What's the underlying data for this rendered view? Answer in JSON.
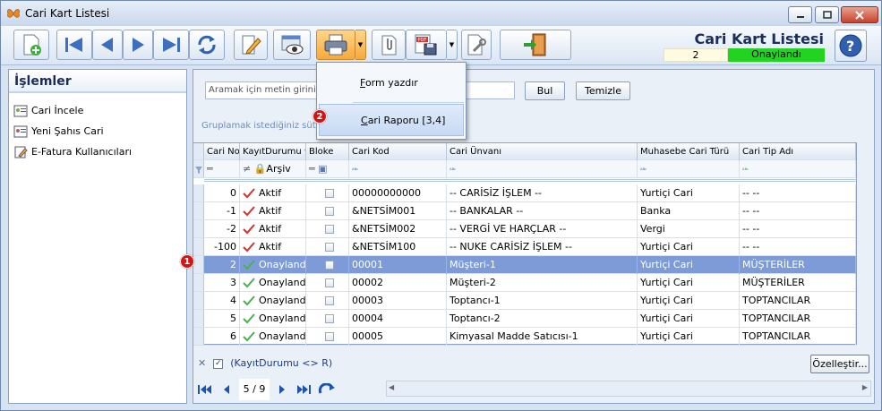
{
  "window": {
    "title": "Cari Kart Listesi"
  },
  "header": {
    "title": "Cari Kart Listesi",
    "record_no": "2",
    "status": "Onaylandı",
    "status_color": "#22d322"
  },
  "sidebar": {
    "title": "İşlemler",
    "items": [
      {
        "label": "Cari İncele",
        "icon": "person-card-icon"
      },
      {
        "label": "Yeni Şahıs Cari",
        "icon": "id-card-icon"
      },
      {
        "label": "E-Fatura Kullanıcıları",
        "icon": "document-edit-icon"
      }
    ]
  },
  "search": {
    "placeholder": "Aramak için metin giriniz...",
    "find_label": "Bul",
    "clear_label": "Temizle"
  },
  "group_hint": "Gruplamak istediğiniz sütun",
  "print_menu": {
    "items": [
      "Form yazdır",
      "Cari Raporu [3,4]"
    ],
    "underline": [
      "F",
      "C"
    ]
  },
  "grid": {
    "columns": [
      "Cari No",
      "KayıtDurumu",
      "Bloke",
      "Cari Kod",
      "Cari Ünvanı",
      "Muhasebe Cari Türü",
      "Cari Tip Adı"
    ],
    "filter_row": {
      "kayit": "Arşiv"
    },
    "rows": [
      {
        "no": "0",
        "status": "Aktif",
        "kod": "00000000000",
        "unvan": "-- CARİSİZ İŞLEM --",
        "tur": "Yurtiçi Cari",
        "tip": "-- --"
      },
      {
        "no": "-1",
        "status": "Aktif",
        "kod": "&NETSİM001",
        "unvan": "-- BANKALAR --",
        "tur": "Banka",
        "tip": "-- --"
      },
      {
        "no": "-2",
        "status": "Aktif",
        "kod": "&NETSİM002",
        "unvan": "-- VERGİ VE HARÇLAR --",
        "tur": "Vergi",
        "tip": "-- --"
      },
      {
        "no": "-100",
        "status": "Aktif",
        "kod": "&NETSİM100",
        "unvan": "-- NUKE CARİSİZ İŞLEM --",
        "tur": "Yurtiçi Cari",
        "tip": "-- --"
      },
      {
        "no": "2",
        "status": "Onaylandı",
        "kod": "00001",
        "unvan": "Müşteri-1",
        "tur": "Yurtiçi Cari",
        "tip": "MÜŞTERİLER"
      },
      {
        "no": "3",
        "status": "Onaylandı",
        "kod": "00002",
        "unvan": "Müşteri-2",
        "tur": "Yurtiçi Cari",
        "tip": "MÜŞTERİLER"
      },
      {
        "no": "4",
        "status": "Onaylandı",
        "kod": "00003",
        "unvan": "Toptancı-1",
        "tur": "Yurtiçi Cari",
        "tip": "TOPTANCILAR"
      },
      {
        "no": "5",
        "status": "Onaylandı",
        "kod": "00004",
        "unvan": "Toptancı-2",
        "tur": "Yurtiçi Cari",
        "tip": "TOPTANCILAR"
      },
      {
        "no": "6",
        "status": "Onaylandı",
        "kod": "00005",
        "unvan": "Kimyasal Madde Satıcısı-1",
        "tur": "Yurtiçi Cari",
        "tip": "TOPTANCILAR"
      }
    ]
  },
  "filter_bar": {
    "text": "(KayıtDurumu <> R)",
    "customize_label": "Özelleştir..."
  },
  "pager": {
    "position": "5 / 9"
  },
  "badges": [
    "1",
    "2"
  ],
  "colors": {
    "selected_row": "#7d9bd7",
    "print_button": "#f7a93a",
    "badge": "#d01515",
    "aktif_check": "#d32f2f",
    "onay_check": "#4caf50"
  }
}
